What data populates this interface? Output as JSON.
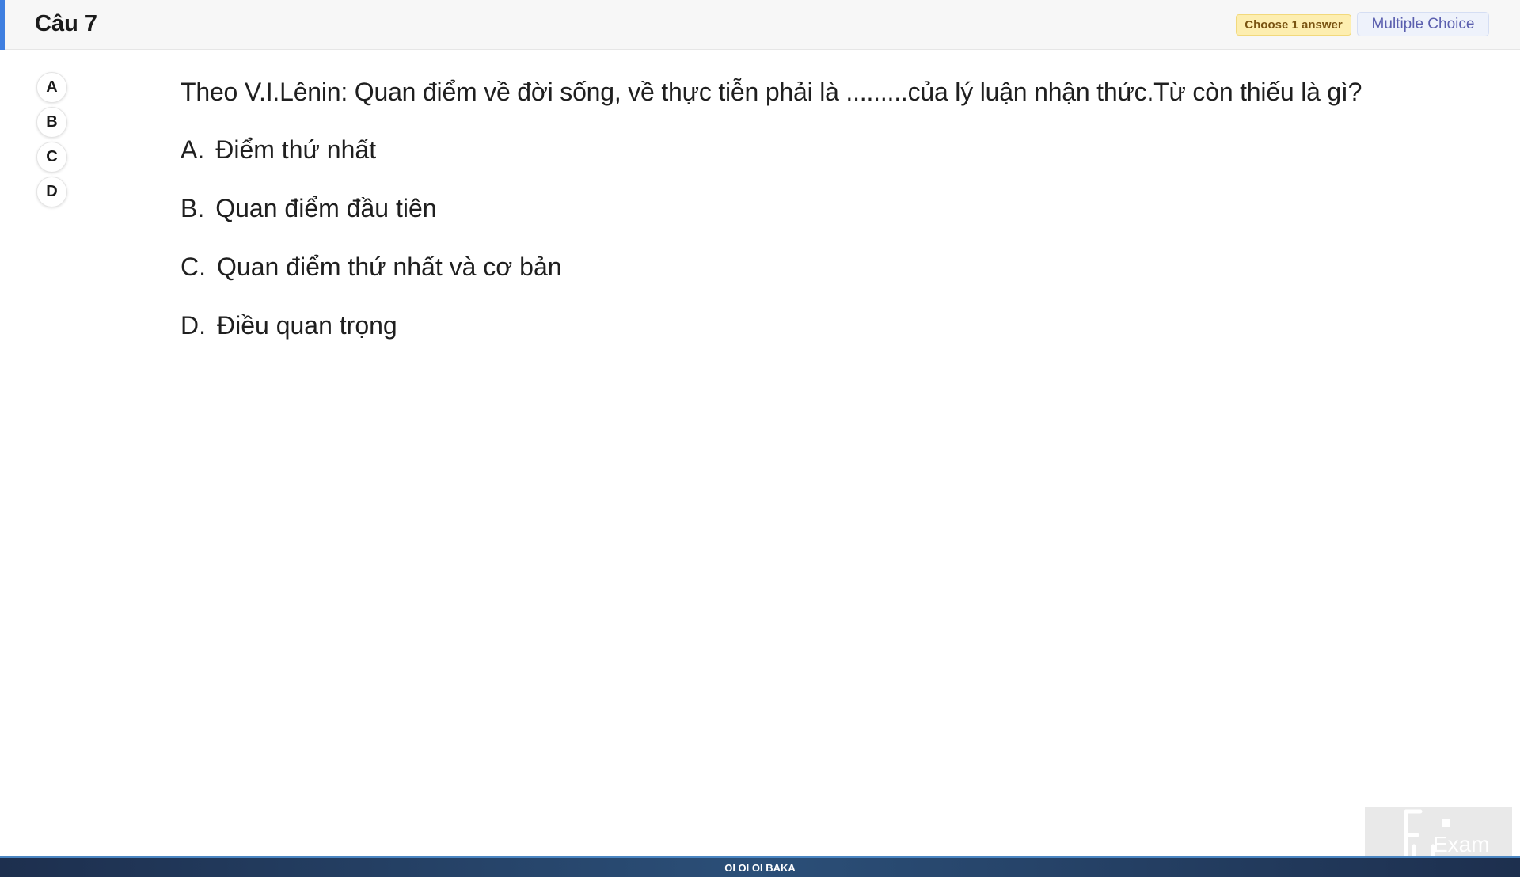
{
  "header": {
    "title": "Câu 7",
    "badge_choose": "Choose 1 answer",
    "badge_type": "Multiple Choice"
  },
  "answer_selector": {
    "choices": [
      "A",
      "B",
      "C",
      "D"
    ]
  },
  "question": {
    "text": "Theo V.I.Lênin: Quan điểm về đời sống, về thực tiễn phải là .........của lý luận nhận thức.Từ còn thiếu là gì?",
    "options": [
      {
        "letter": "A.",
        "text": "Điểm thứ nhất"
      },
      {
        "letter": "B.",
        "text": "Quan điểm đầu tiên"
      },
      {
        "letter": "C.",
        "text": "Quan điểm thứ nhất và cơ bản"
      },
      {
        "letter": "D.",
        "text": "Điều quan trọng"
      }
    ]
  },
  "logo": {
    "text": "Exam",
    "icon": "fu-exam-logo-icon"
  },
  "footer": {
    "text": "OI OI OI BAKA"
  },
  "colors": {
    "accent": "#3f7fe0",
    "badge_choose_bg": "#fdeeb0",
    "badge_type_text": "#5b5fae",
    "footer_bg": "#2b4f78"
  }
}
